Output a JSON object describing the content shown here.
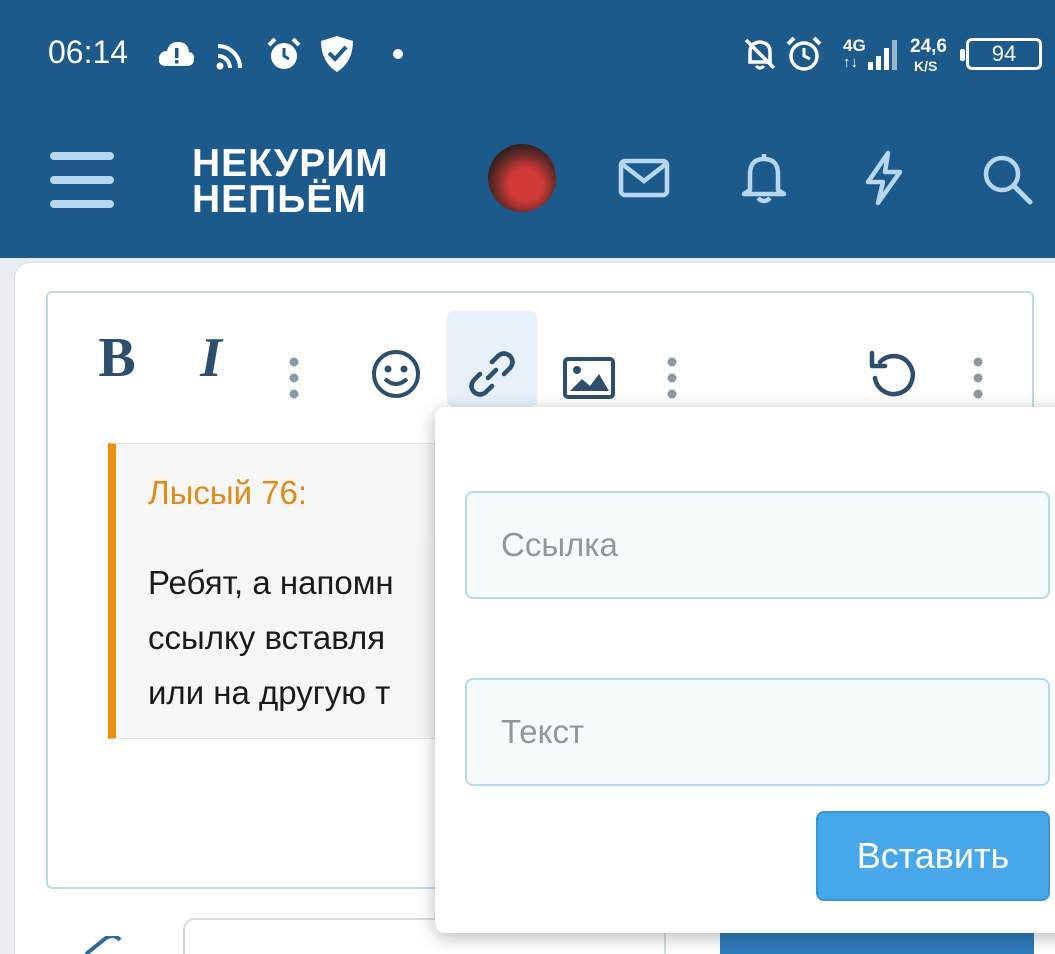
{
  "status_bar": {
    "time": "06:14",
    "network": "4G",
    "speed_value": "24,6",
    "speed_unit": "K/S",
    "battery": "94",
    "icons": [
      "cloud-alert-icon",
      "cast-icon",
      "alarm-icon",
      "shield-check-icon",
      "dot-icon",
      "bell-off-icon",
      "alarm-icon",
      "signal-icon"
    ]
  },
  "header": {
    "logo_line1": "НЕКУРИМ",
    "logo_line2": "НЕПЬЁМ",
    "icons": [
      "menu-icon",
      "avatar",
      "mail-icon",
      "bell-icon",
      "bolt-icon",
      "search-icon"
    ]
  },
  "toolbar": {
    "bold": "B",
    "italic": "I",
    "icons": [
      "bold-icon",
      "italic-icon",
      "more-icon",
      "smile-icon",
      "link-icon",
      "image-icon",
      "more-icon",
      "undo-icon",
      "more-icon"
    ]
  },
  "quote": {
    "author": "Лысый 76:",
    "lines": [
      "Ребят, а напомн",
      "ссылку вставля",
      "или на другую т"
    ]
  },
  "link_dialog": {
    "url_placeholder": "Ссылка",
    "text_placeholder": "Текст",
    "insert_label": "Вставить"
  },
  "colors": {
    "brand": "#1b5a8a",
    "quote_accent": "#f0900f",
    "button": "#47a7eb"
  }
}
